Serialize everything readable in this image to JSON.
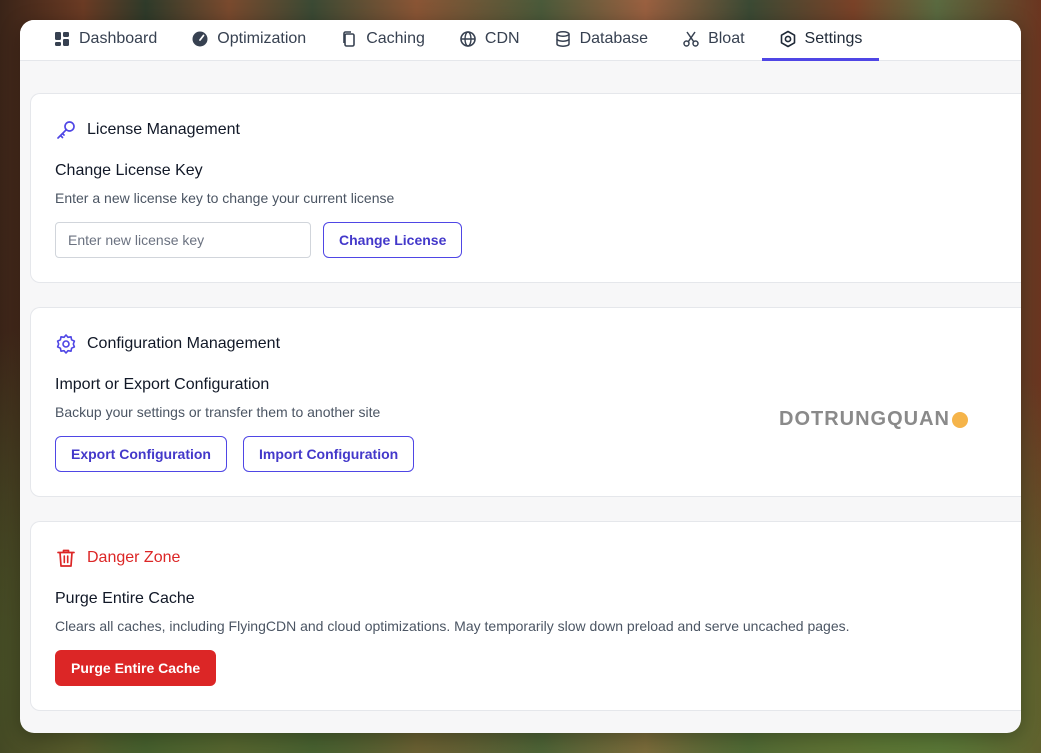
{
  "tabs": [
    {
      "label": "Dashboard",
      "icon": "dashboard-icon"
    },
    {
      "label": "Optimization",
      "icon": "gauge-icon"
    },
    {
      "label": "Caching",
      "icon": "copy-icon"
    },
    {
      "label": "CDN",
      "icon": "globe-icon"
    },
    {
      "label": "Database",
      "icon": "database-icon"
    },
    {
      "label": "Bloat",
      "icon": "scissors-icon"
    },
    {
      "label": "Settings",
      "icon": "settings-icon",
      "active": true
    }
  ],
  "license": {
    "title": "License Management",
    "subtitle": "Change License Key",
    "description": "Enter a new license key to change your current license",
    "placeholder": "Enter new license key",
    "button": "Change License"
  },
  "config": {
    "title": "Configuration Management",
    "subtitle": "Import or Export Configuration",
    "description": "Backup your settings or transfer them to another site",
    "export_button": "Export Configuration",
    "import_button": "Import Configuration"
  },
  "danger": {
    "title": "Danger Zone",
    "subtitle": "Purge Entire Cache",
    "description": "Clears all caches, including FlyingCDN and cloud optimizations. May temporarily slow down preload and serve uncached pages.",
    "button": "Purge Entire Cache"
  },
  "watermark": {
    "text": "DOTRUNGQUAN"
  },
  "colors": {
    "accent": "#4f46e5",
    "danger": "#dc2626"
  }
}
